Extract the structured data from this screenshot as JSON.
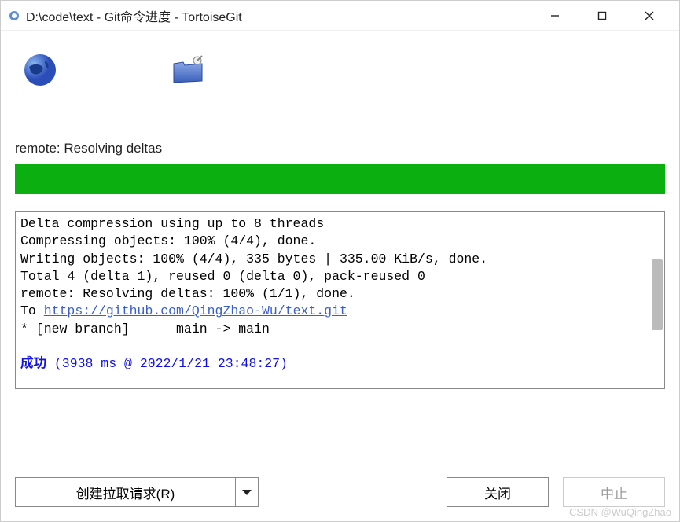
{
  "titlebar": {
    "title": "D:\\code\\text - Git命令进度 - TortoiseGit"
  },
  "status": "remote: Resolving deltas",
  "log": {
    "lines": [
      "Delta compression using up to 8 threads",
      "Compressing objects: 100% (4/4), done.",
      "Writing objects: 100% (4/4), 335 bytes | 335.00 KiB/s, done.",
      "Total 4 (delta 1), reused 0 (delta 0), pack-reused 0",
      "remote: Resolving deltas: 100% (1/1), done."
    ],
    "to_prefix": "To ",
    "link": "https://github.com/QingZhao-Wu/text.git",
    "branch_line": "* [new branch]      main -> main",
    "success_label": "成功",
    "timestamp": " (3938 ms @ 2022/1/21 23:48:27)"
  },
  "buttons": {
    "pull_request": "创建拉取请求(R)",
    "close": "关闭",
    "abort": "中止"
  },
  "watermark": "CSDN @WuQingZhao"
}
